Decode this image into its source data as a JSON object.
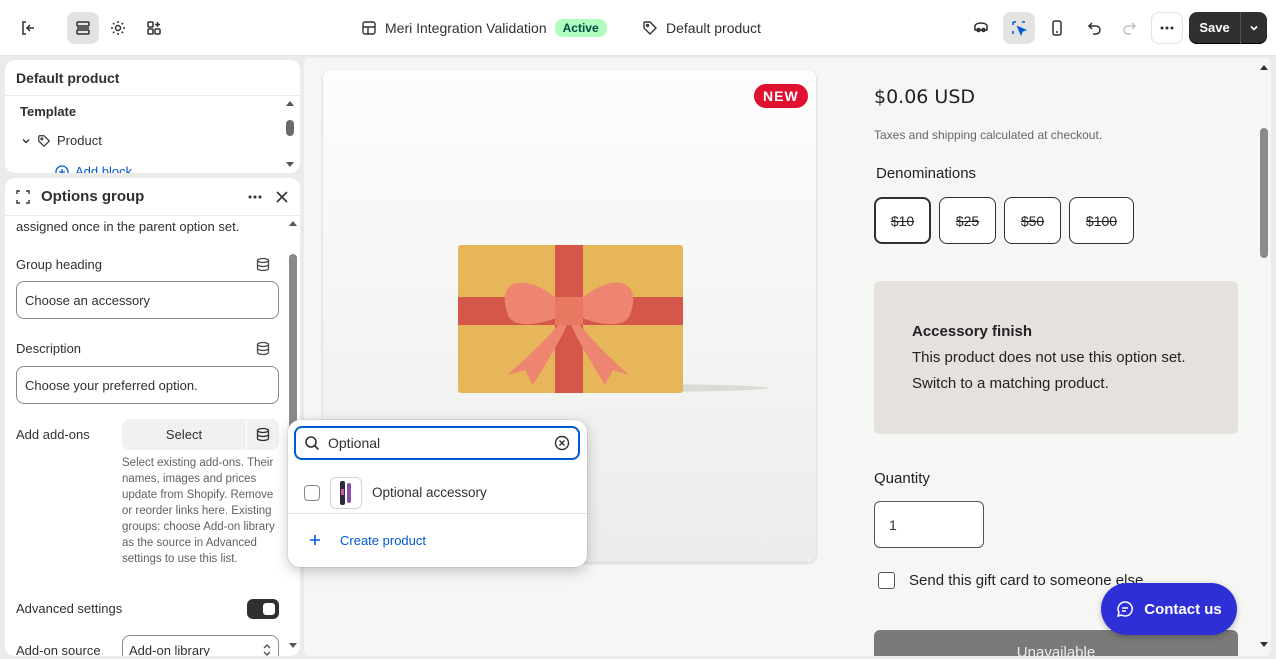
{
  "topbar": {
    "store_name": "Meri Integration Validation",
    "status": "Active",
    "template_name": "Default product",
    "save_label": "Save"
  },
  "sidebar": {
    "section_title": "Default product",
    "template_heading": "Template",
    "tree_item": "Product",
    "add_block": "Add block"
  },
  "block_panel": {
    "title": "Options group",
    "intro_text": "assigned once in the parent option set.",
    "group_heading_label": "Group heading",
    "group_heading_value": "Choose an accessory",
    "description_label": "Description",
    "description_value": "Choose your preferred option.",
    "add_ons_label": "Add add-ons",
    "select_label": "Select",
    "help_text": "Select existing add-ons. Their names, images and prices update from Shopify. Remove or reorder links here. Existing groups: choose Add-on library as the source in Advanced settings to use this list.",
    "advanced_label": "Advanced settings",
    "advanced_enabled": true,
    "source_label": "Add-on source",
    "source_value": "Add-on library"
  },
  "picker": {
    "search_value": "Optional",
    "result_label": "Optional accessory",
    "create_label": "Create product"
  },
  "preview": {
    "badge": "NEW",
    "price": "$0.06 USD",
    "tax_note": "Taxes and shipping calculated at checkout.",
    "denominations_label": "Denominations",
    "denominations": [
      "$10",
      "$25",
      "$50",
      "$100"
    ],
    "selected_denomination": "$10",
    "notice_title": "Accessory finish",
    "notice_line1": "This product does not use this option set.",
    "notice_line2": "Switch to a matching product.",
    "quantity_label": "Quantity",
    "quantity_value": "1",
    "gift_label": "Send this gift card to someone else",
    "unavailable_label": "Unavailable",
    "contact_label": "Contact us"
  },
  "colors": {
    "accent": "#005bd3",
    "active_badge_bg": "#affebf",
    "new_badge": "#e0102f",
    "contact_button": "#2f2fd8",
    "dark_button": "#303030"
  }
}
